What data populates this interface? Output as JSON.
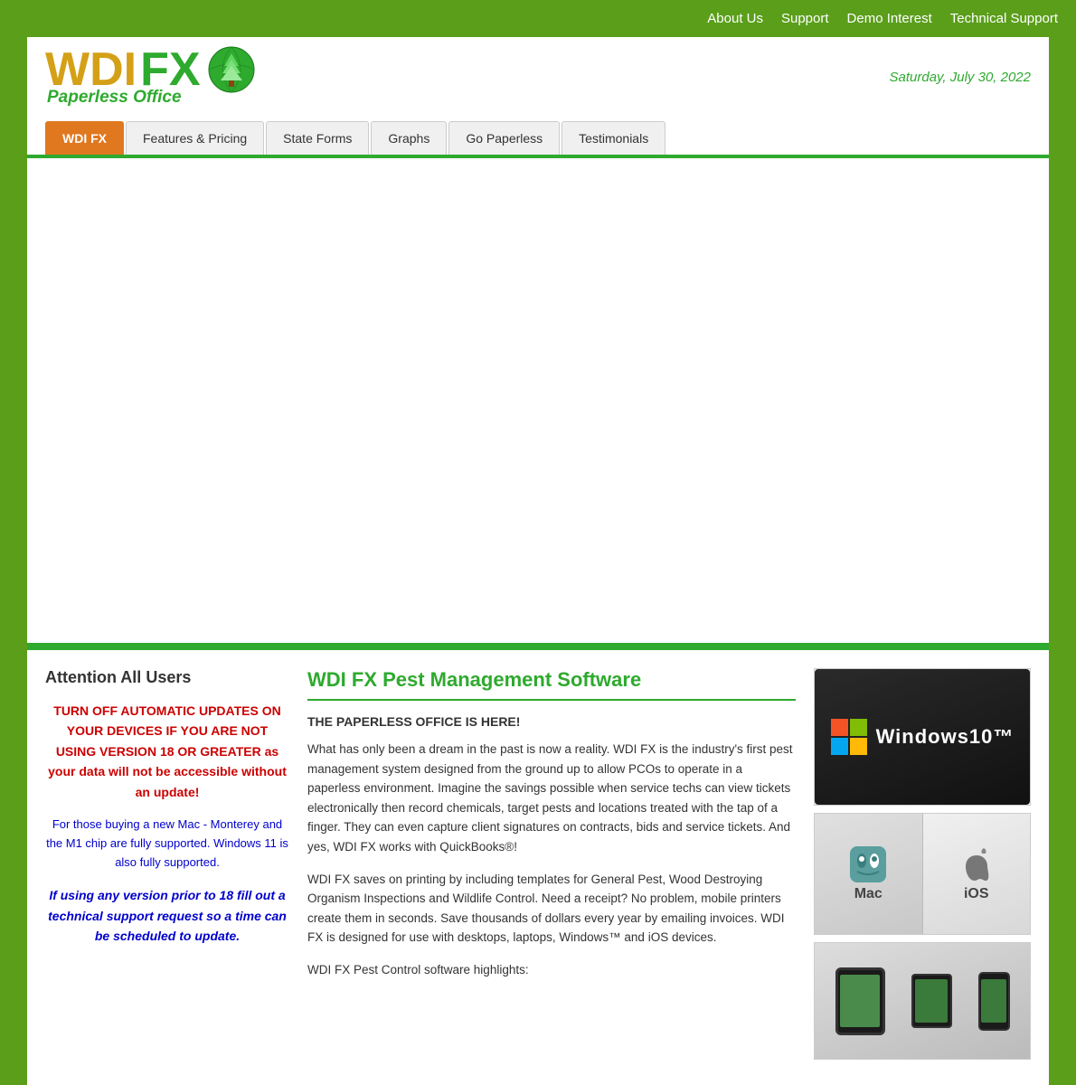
{
  "topnav": {
    "links": [
      {
        "label": "About Us",
        "href": "#"
      },
      {
        "label": "Support",
        "href": "#"
      },
      {
        "label": "Demo Interest",
        "href": "#"
      },
      {
        "label": "Technical Support",
        "href": "#"
      }
    ]
  },
  "header": {
    "logo_wdi": "WDI",
    "logo_fx": "FX",
    "logo_subtitle": "Paperless Office",
    "date": "Saturday, July 30, 2022"
  },
  "nav": {
    "tabs": [
      {
        "label": "WDI FX",
        "active": true
      },
      {
        "label": "Features & Pricing",
        "active": false
      },
      {
        "label": "State Forms",
        "active": false
      },
      {
        "label": "Graphs",
        "active": false
      },
      {
        "label": "Go Paperless",
        "active": false
      },
      {
        "label": "Testimonials",
        "active": false
      }
    ]
  },
  "sidebar": {
    "title": "Attention All Users",
    "warning": "TURN OFF AUTOMATIC UPDATES ON YOUR DEVICES IF YOU ARE NOT USING VERSION 18 OR GREATER as your data will not be accessible without an update!",
    "info": "For those buying a new Mac - Monterey and the M1 chip are fully supported. Windows 11 is also fully supported.",
    "support": "If using any version prior to 18 fill out a technical support request so a time can be scheduled to update."
  },
  "main": {
    "title": "WDI FX Pest Management Software",
    "subtitle": "THE PAPERLESS OFFICE IS HERE!",
    "paragraphs": [
      "What has only been a dream in the past is now a reality. WDI FX is the industry's first pest management system designed from the ground up to allow PCOs to operate in a paperless environment. Imagine the savings possible when service techs can view tickets electronically then record chemicals, target pests and locations treated with the tap of a finger. They can even capture client signatures on contracts, bids and service tickets. And yes, WDI FX works with QuickBooks®!",
      "WDI FX saves on printing by including templates for General Pest, Wood Destroying Organism Inspections and Wildlife Control. Need a receipt? No problem, mobile printers create them in seconds. Save thousands of dollars every year by emailing invoices. WDI FX is designed for use with desktops, laptops, Windows™ and iOS devices.",
      "WDI FX Pest Control software highlights:"
    ]
  },
  "images": {
    "windows10_label": "Windows10™",
    "mac_label": "Mac",
    "ios_label": "iOS"
  }
}
